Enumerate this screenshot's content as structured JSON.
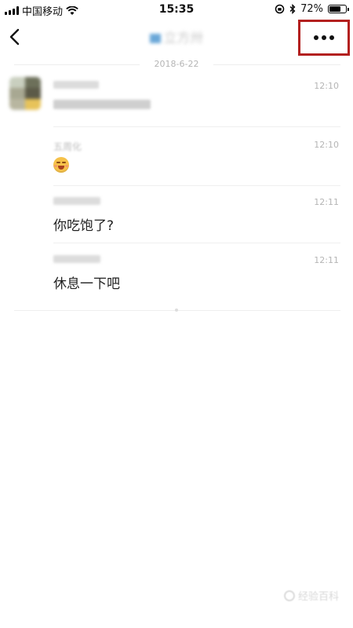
{
  "status_bar": {
    "carrier": "中国移动",
    "time": "15:35",
    "battery_percent": "72%",
    "battery_level": 0.72
  },
  "nav": {
    "title": "立方卅"
  },
  "date_divider": "2018-6-22",
  "messages": [
    {
      "name": "",
      "time": "12:10",
      "body": ""
    },
    {
      "name": "五周化",
      "time": "12:10",
      "body_icon": "grimacing-face-emoji"
    },
    {
      "name": "",
      "time": "12:11",
      "body": "你吃饱了?"
    },
    {
      "name": "",
      "time": "12:11",
      "body": "休息一下吧"
    }
  ],
  "watermark": "经验百科"
}
